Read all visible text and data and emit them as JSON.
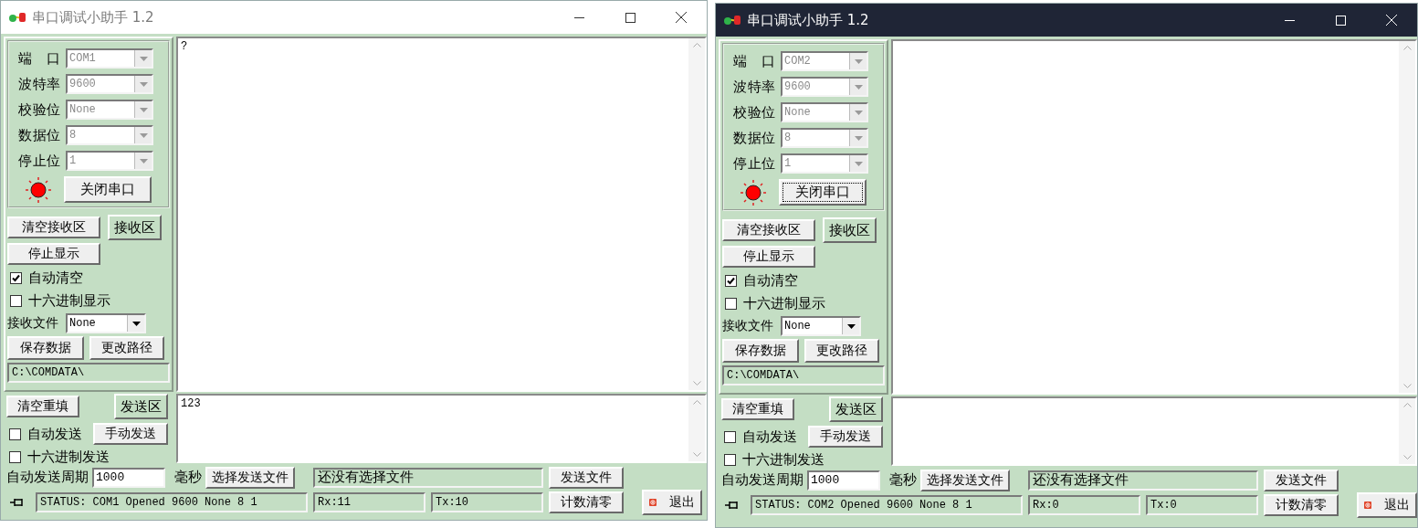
{
  "windows": [
    {
      "title": "串口调试小助手 1.2",
      "active": false,
      "port_settings": [
        {
          "label": "端 口",
          "value": "COM1",
          "disabled": true
        },
        {
          "label": "波特率",
          "value": "9600",
          "disabled": true
        },
        {
          "label": "校验位",
          "value": "None",
          "disabled": true
        },
        {
          "label": "数据位",
          "value": "8",
          "disabled": true
        },
        {
          "label": "停止位",
          "value": "1",
          "disabled": true
        }
      ],
      "led_on": true,
      "port_button": {
        "label": "关闭串口",
        "focused": false
      },
      "receive_buttons": [
        "清空接收区",
        "停止显示"
      ],
      "receive_area_label": "接收区",
      "receive_checkboxes": [
        {
          "label": "自动清空",
          "checked": true
        },
        {
          "label": "十六进制显示",
          "checked": false
        }
      ],
      "receive_file": {
        "label": "接收文件",
        "value": "None",
        "disabled": false
      },
      "save_buttons": [
        "保存数据",
        "更改路径"
      ],
      "path": "C:\\COMDATA\\",
      "receive_text": "?",
      "send_clear_button": "清空重填",
      "send_area_label": "发送区",
      "auto_send": {
        "label": "自动发送",
        "checked": false
      },
      "manual_send_button": "手动发送",
      "hex_send": {
        "label": "十六进制发送",
        "checked": false
      },
      "send_text": "123",
      "period_label": "自动发送周期",
      "period_value": "1000",
      "period_unit": "毫秒",
      "choose_file_button": "选择发送文件",
      "file_status": "还没有选择文件",
      "send_file_button": "发送文件",
      "status": "STATUS: COM1 Opened 9600 None 8 1",
      "rx": "Rx:11",
      "tx": "Tx:10",
      "reset_count_button": "计数清零",
      "exit_button": "退出"
    },
    {
      "title": "串口调试小助手 1.2",
      "active": true,
      "port_settings": [
        {
          "label": "端 口",
          "value": "COM2",
          "disabled": true
        },
        {
          "label": "波特率",
          "value": "9600",
          "disabled": true
        },
        {
          "label": "校验位",
          "value": "None",
          "disabled": true
        },
        {
          "label": "数据位",
          "value": "8",
          "disabled": true
        },
        {
          "label": "停止位",
          "value": "1",
          "disabled": true
        }
      ],
      "led_on": true,
      "port_button": {
        "label": "关闭串口",
        "focused": true
      },
      "receive_buttons": [
        "清空接收区",
        "停止显示"
      ],
      "receive_area_label": "接收区",
      "receive_checkboxes": [
        {
          "label": "自动清空",
          "checked": true
        },
        {
          "label": "十六进制显示",
          "checked": false
        }
      ],
      "receive_file": {
        "label": "接收文件",
        "value": "None",
        "disabled": false
      },
      "save_buttons": [
        "保存数据",
        "更改路径"
      ],
      "path": "C:\\COMDATA\\",
      "send_clear_button": "清空重填",
      "send_area_label": "发送区",
      "auto_send": {
        "label": "自动发送",
        "checked": false
      },
      "manual_send_button": "手动发送",
      "hex_send": {
        "label": "十六进制发送",
        "checked": false
      },
      "period_label": "自动发送周期",
      "period_value": "1000",
      "period_unit": "毫秒",
      "choose_file_button": "选择发送文件",
      "file_status": "还没有选择文件",
      "send_file_button": "发送文件",
      "status": "STATUS: COM2 Opened 9600 None 8 1",
      "rx": "Rx:0",
      "tx": "Tx:0",
      "reset_count_button": "计数清零",
      "exit_button": "退出"
    }
  ]
}
